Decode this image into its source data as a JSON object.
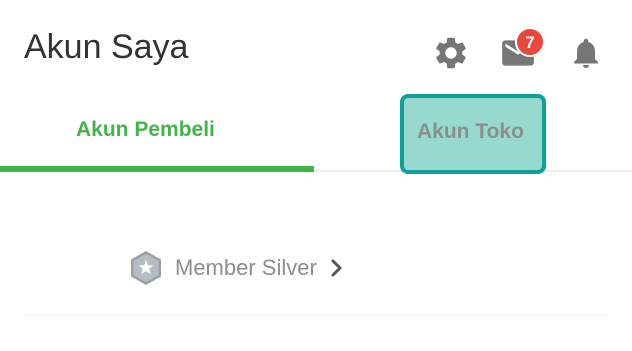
{
  "header": {
    "title": "Akun Saya",
    "icons": [
      "gear-icon",
      "mail-icon",
      "bell-icon"
    ],
    "mail_badge": "7"
  },
  "tabs": [
    {
      "label": "Akun Pembeli",
      "selected": true
    },
    {
      "label": "Akun Toko",
      "selected": false,
      "highlighted": true
    }
  ],
  "member": {
    "label": "Member Silver",
    "icon": "silver-badge-icon"
  },
  "colors": {
    "accent_green": "#42b549",
    "highlight_fill": "#97d9cf",
    "highlight_border": "#10a09a",
    "badge_red": "#e8483d",
    "icon_gray": "#767676"
  }
}
